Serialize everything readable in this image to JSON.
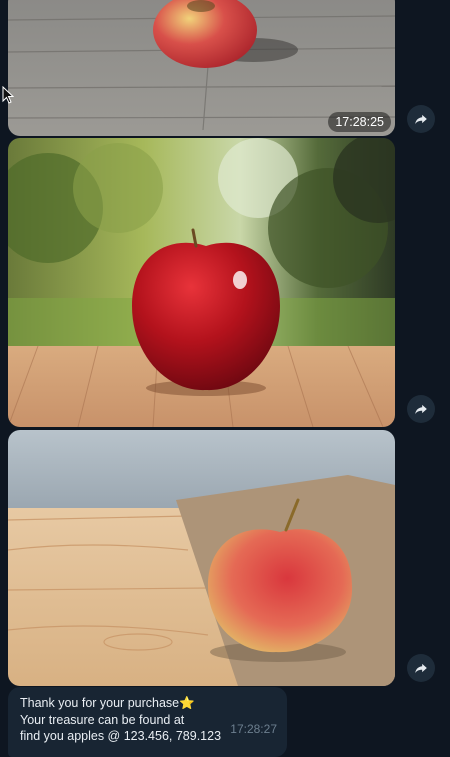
{
  "messages": [
    {
      "type": "photo",
      "subject": "red-yellow apple on grey wooden table",
      "time": "17:28:25"
    },
    {
      "type": "photo",
      "subject": "red apple on wooden table with trees behind",
      "time": ""
    },
    {
      "type": "photo",
      "subject": "red-yellow apple on burlap and light wood",
      "time": ""
    }
  ],
  "text_message": {
    "line1": "Thank you for your purchase",
    "star": "⭐",
    "line2": "Your treasure can be found at",
    "line3": "find you apples @ 123.456, 789.123",
    "time": "17:28:27"
  },
  "icons": [
    "share-icon",
    "mouse-cursor-icon"
  ],
  "colors": {
    "background": "#0e1621",
    "bubble": "#182533",
    "share_button": "#1e2c3a"
  }
}
